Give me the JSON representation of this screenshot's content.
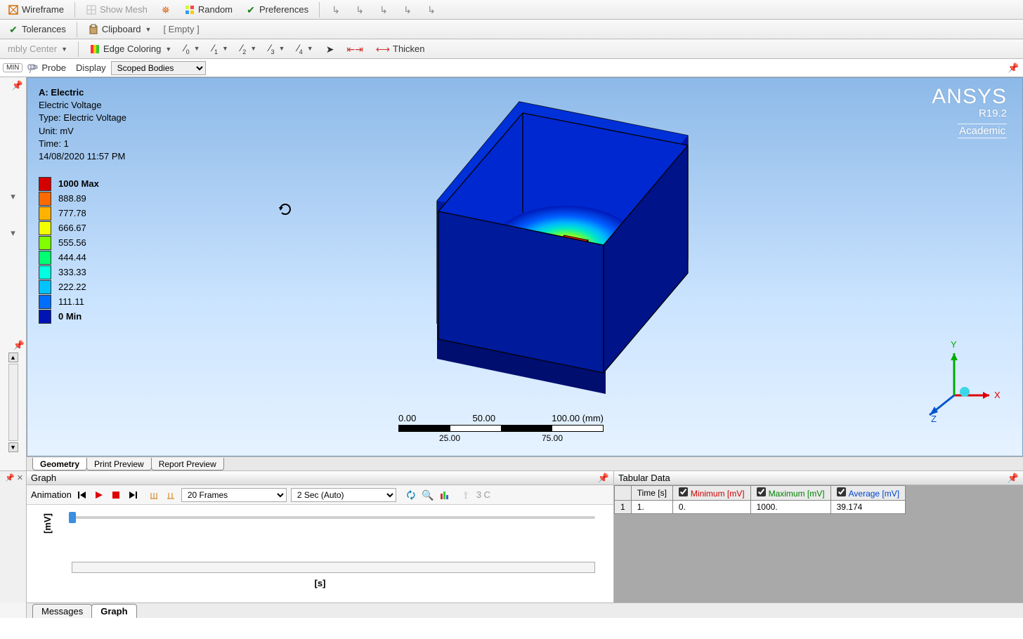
{
  "toolbars": {
    "row1": {
      "wireframe": "Wireframe",
      "show_mesh": "Show Mesh",
      "random": "Random",
      "preferences": "Preferences"
    },
    "row2": {
      "tolerances": "Tolerances",
      "clipboard": "Clipboard",
      "empty": "[ Empty ]"
    },
    "row3": {
      "center_label": "mbly Center",
      "edge_coloring": "Edge Coloring",
      "thicken": "Thicken"
    }
  },
  "display_bar": {
    "min_label": "MIN",
    "probe": "Probe",
    "display": "Display",
    "selector": "Scoped Bodies"
  },
  "viewport": {
    "title": "A: Electric",
    "result_name": "Electric Voltage",
    "type": "Type: Electric Voltage",
    "unit": "Unit: mV",
    "time": "Time: 1",
    "timestamp": "14/08/2020 11:57 PM",
    "legend": [
      {
        "color": "#d40000",
        "label": "1000 Max",
        "bold": true
      },
      {
        "color": "#ff6a00",
        "label": "888.89"
      },
      {
        "color": "#ffb200",
        "label": "777.78"
      },
      {
        "color": "#f3ff00",
        "label": "666.67"
      },
      {
        "color": "#7fff00",
        "label": "555.56"
      },
      {
        "color": "#00ff73",
        "label": "444.44"
      },
      {
        "color": "#00ffe0",
        "label": "333.33"
      },
      {
        "color": "#00c4ff",
        "label": "222.22"
      },
      {
        "color": "#006eff",
        "label": "111.11"
      },
      {
        "color": "#0014b4",
        "label": "0 Min",
        "bold": true
      }
    ],
    "brand": {
      "name": "ANSYS",
      "version": "R19.2",
      "edition": "Academic"
    },
    "triad": {
      "x": "X",
      "y": "Y",
      "z": "Z"
    },
    "scale": {
      "ticks": [
        "0.00",
        "50.00",
        "100.00 (mm)"
      ],
      "subticks": [
        "25.00",
        "75.00"
      ]
    },
    "tabs": {
      "geometry": "Geometry",
      "print_preview": "Print Preview",
      "report_preview": "Report Preview"
    }
  },
  "graph": {
    "title": "Graph",
    "animation_label": "Animation",
    "frames_selector": "20 Frames",
    "duration_selector": "2 Sec (Auto)",
    "three_c": "3 C",
    "ylabel": "[mV]",
    "xlabel": "[s]"
  },
  "tabular": {
    "title": "Tabular Data",
    "headers": {
      "time": "Time [s]",
      "min": "Minimum [mV]",
      "max": "Maximum [mV]",
      "avg": "Average [mV]"
    },
    "rows": [
      {
        "idx": "1",
        "time": "1.",
        "min": "0.",
        "max": "1000.",
        "avg": "39.174"
      }
    ]
  },
  "bottom_tabs": {
    "messages": "Messages",
    "graph": "Graph"
  }
}
